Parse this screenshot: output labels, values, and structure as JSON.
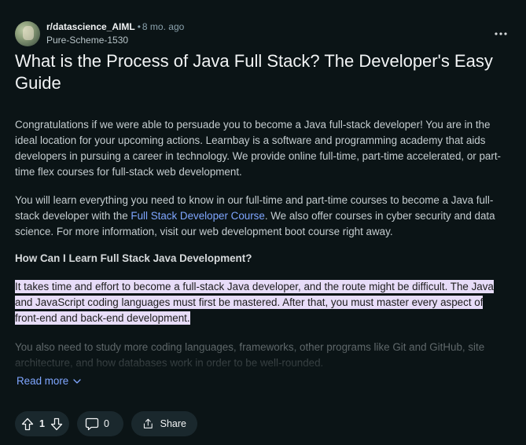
{
  "post": {
    "subreddit": "r/datascience_AIML",
    "separator": "•",
    "time": "8 mo. ago",
    "author": "Pure-Scheme-1530",
    "title": "What is the Process of Java Full Stack? The Developer's Easy Guide",
    "paragraph1": "Congratulations if we were able to persuade you to become a Java full-stack developer! You are in the ideal location for your upcoming actions. Learnbay is a software and programming academy that aids developers in pursuing a career in technology. We provide online full-time, part-time accelerated, or part-time flex courses for full-stack web development.",
    "paragraph2": {
      "before": "You will learn everything you need to know in our full-time and part-time courses to become a Java full-stack developer with the ",
      "link": "Full Stack Developer Course",
      "after": ". We also offer courses in cyber security and data science. For more information, visit our web development boot course right away."
    },
    "heading": "How Can I Learn Full Stack Java Development?",
    "paragraph3": "It takes time and effort to become a full-stack Java developer, and the route might be difficult. The Java and JavaScript coding languages must first be mastered. After that, you must master every aspect of front-end and back-end development.",
    "paragraph4": "You also need to study more coding languages, frameworks, other programs like Git and GitHub, site architecture, and how databases work in order to be well-rounded.",
    "read_more": "Read more"
  },
  "actions": {
    "vote_count": "1",
    "comment_count": "0",
    "share_label": "Share"
  },
  "icons": {
    "overflow": "overflow-menu-icon",
    "upvote": "upvote-icon",
    "downvote": "downvote-icon",
    "comment": "comment-icon",
    "share": "share-icon",
    "read_more": "chevron-down-icon"
  },
  "colors": {
    "background": "#0b1416",
    "link": "#7fa6ff",
    "highlight": "#e7dcf8",
    "pill": "#1a282d"
  }
}
